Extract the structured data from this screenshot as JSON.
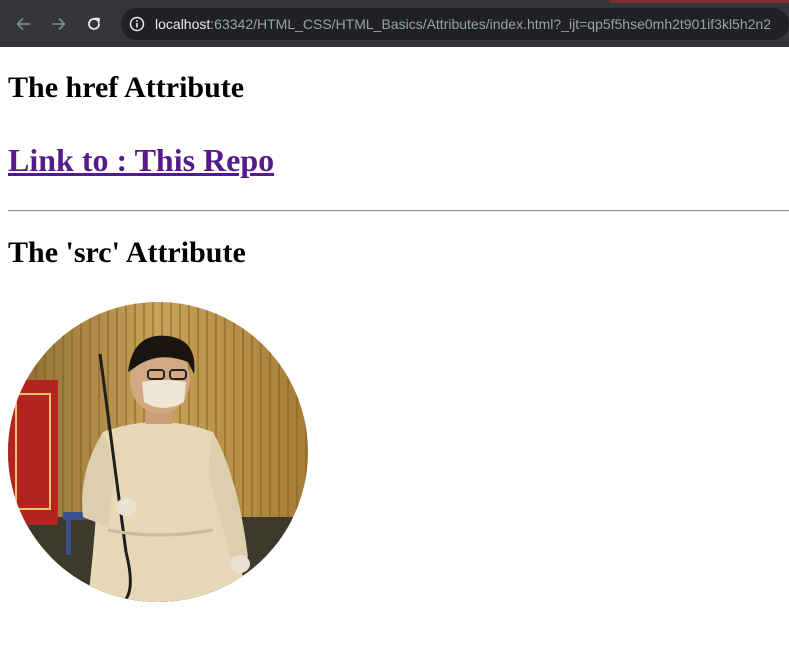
{
  "browser": {
    "address": {
      "host": "localhost",
      "rest": ":63342/HTML_CSS/HTML_Basics/Attributes/index.html?_ijt=qp5f5hse0mh2t901if3kl5h2n2"
    },
    "icons": [
      "back-arrow-icon",
      "forward-arrow-icon",
      "reload-icon",
      "site-info-icon"
    ]
  },
  "page": {
    "heading_href": "The href Attribute",
    "link_text": "Link to : This Repo",
    "heading_src": "The 'src' Attribute"
  },
  "colors": {
    "link": "#551a8b",
    "toolbar": "#35363a",
    "omnibox": "#202124"
  }
}
